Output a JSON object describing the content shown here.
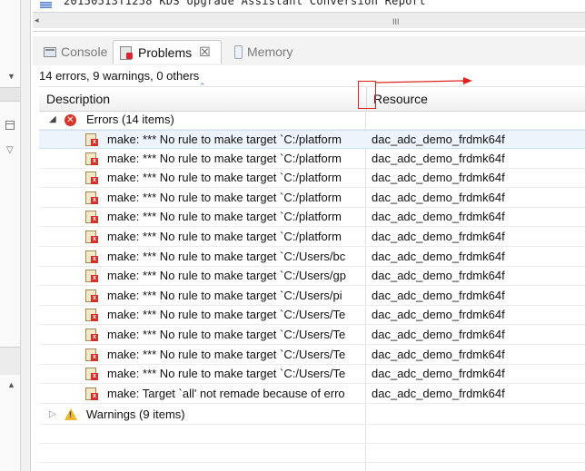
{
  "top_editor": {
    "report_line": "20150513T1258 KDS Upgrade Assistant Conversion Report",
    "grip": "III"
  },
  "tabs": [
    {
      "label": "Console",
      "icon": "console-icon",
      "active": false
    },
    {
      "label": "Problems",
      "icon": "problems-icon",
      "active": true,
      "close": "☒"
    },
    {
      "label": "Memory",
      "icon": "memory-icon",
      "active": false
    }
  ],
  "summary": "14 errors, 9 warnings, 0 others",
  "table": {
    "col_description": "Description",
    "col_resource": "Resource"
  },
  "errors_group": {
    "label": "Errors (14 items)",
    "icon": "error-circle-icon",
    "expanded": true
  },
  "warnings_group": {
    "label": "Warnings (9 items)",
    "icon": "warning-triangle-icon",
    "expanded": false
  },
  "error_rows": [
    {
      "desc": "make: *** No rule to make target `C:/platform",
      "res": "dac_adc_demo_frdmk64f"
    },
    {
      "desc": "make: *** No rule to make target `C:/platform",
      "res": "dac_adc_demo_frdmk64f"
    },
    {
      "desc": "make: *** No rule to make target `C:/platform",
      "res": "dac_adc_demo_frdmk64f"
    },
    {
      "desc": "make: *** No rule to make target `C:/platform",
      "res": "dac_adc_demo_frdmk64f"
    },
    {
      "desc": "make: *** No rule to make target `C:/platform",
      "res": "dac_adc_demo_frdmk64f"
    },
    {
      "desc": "make: *** No rule to make target `C:/platform",
      "res": "dac_adc_demo_frdmk64f"
    },
    {
      "desc": "make: *** No rule to make target `C:/Users/bc",
      "res": "dac_adc_demo_frdmk64f"
    },
    {
      "desc": "make: *** No rule to make target `C:/Users/gp",
      "res": "dac_adc_demo_frdmk64f"
    },
    {
      "desc": "make: *** No rule to make target `C:/Users/pi",
      "res": "dac_adc_demo_frdmk64f"
    },
    {
      "desc": "make: *** No rule to make target `C:/Users/Te",
      "res": "dac_adc_demo_frdmk64f"
    },
    {
      "desc": "make: *** No rule to make target `C:/Users/Te",
      "res": "dac_adc_demo_frdmk64f"
    },
    {
      "desc": "make: *** No rule to make target `C:/Users/Te",
      "res": "dac_adc_demo_frdmk64f"
    },
    {
      "desc": "make: *** No rule to make target `C:/Users/Te",
      "res": "dac_adc_demo_frdmk64f"
    },
    {
      "desc": "make: Target `all' not remade because of erro",
      "res": "dac_adc_demo_frdmk64f"
    }
  ],
  "colors": {
    "annotation": "#e0241d",
    "error": "#d9362b",
    "warning": "#f0b828",
    "selected_row": "#eef4fc"
  }
}
